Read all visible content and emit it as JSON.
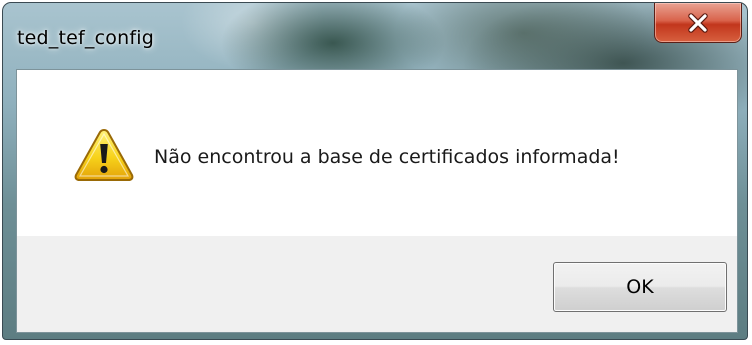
{
  "window": {
    "title": "ted_tef_config"
  },
  "dialog": {
    "message": "Não encontrou a base de certificados informada!",
    "icon": "warning-icon",
    "ok_label": "OK"
  },
  "colors": {
    "close_button": "#c2361c",
    "warning_yellow": "#f7d21a",
    "button_area": "#f0f0f0"
  }
}
